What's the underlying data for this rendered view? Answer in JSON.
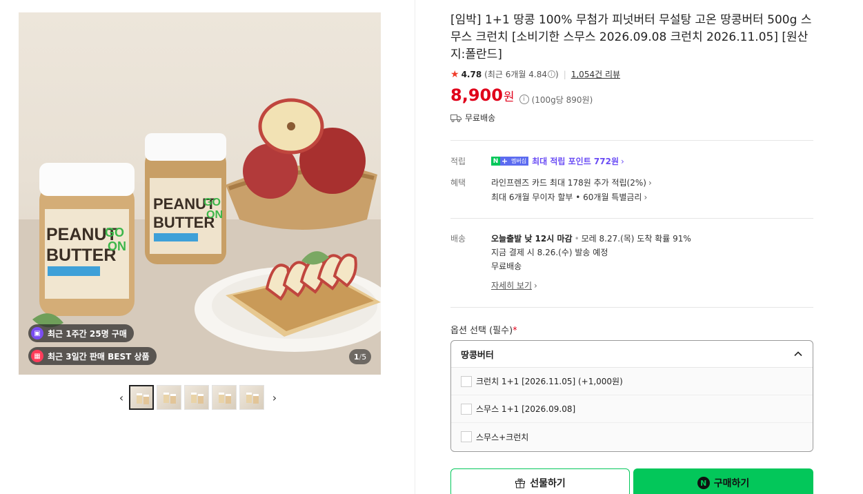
{
  "gallery": {
    "badges": [
      {
        "icon": "bag-icon",
        "text": "최근 1주간 25명 구매"
      },
      {
        "icon": "gift-box-icon",
        "text": "최근 3일간 판매 BEST 상품"
      }
    ],
    "page_current": "1",
    "page_total": "5",
    "thumbnail_count": 5
  },
  "product": {
    "title": "[임박] 1+1 땅콩 100% 무첨가 피넛버터 무설탕 고온 땅콩버터 500g 스무스 크런치 [소비기한 스무스 2026.09.08 크런치 2026.11.05] [원산지:폴란드]",
    "rating": "4.78",
    "rating_recent": "(최근 6개월 4.84",
    "rating_recent_close": ")",
    "review_count": "1,054건 리뷰",
    "price": "8,900",
    "price_currency": "원",
    "unit_price": "(100g당 890원)",
    "shipping_badge": "무료배송"
  },
  "benefits": {
    "points_label": "적립",
    "npay_n": "N",
    "npay_plus": "+",
    "npay_membership": "멤버십",
    "points_text": "최대 적립 포인트 772원",
    "perks_label": "혜택",
    "perk_card": "라인프렌즈 카드 최대 178원 추가 적립(2%)",
    "perk_installment": "최대 6개월 무이자 할부 • 60개월 특별금리"
  },
  "delivery": {
    "label": "배송",
    "today_cutoff": "오늘출발 낮 12시 마감",
    "separator": "•",
    "arrival": "모레 8.27.(목) 도착 확률 91%",
    "dispatch": "지금 결제 시 8.26.(수) 발송 예정",
    "fee": "무료배송",
    "details_link": "자세히 보기"
  },
  "options": {
    "label": "옵션 선택 (필수)",
    "required_mark": "*",
    "selected": "땅콩버터",
    "items": [
      "크런치 1+1 [2026.11.05] (+1,000원)",
      "스무스 1+1 [2026.09.08]",
      "스무스+크런치"
    ]
  },
  "actions": {
    "gift_label": "선물하기",
    "buy_label": "구매하기",
    "buy_icon_letter": "N"
  },
  "colors": {
    "price_red": "#e0001a",
    "naver_green": "#03c75a",
    "point_purple": "#6a4cf5"
  }
}
